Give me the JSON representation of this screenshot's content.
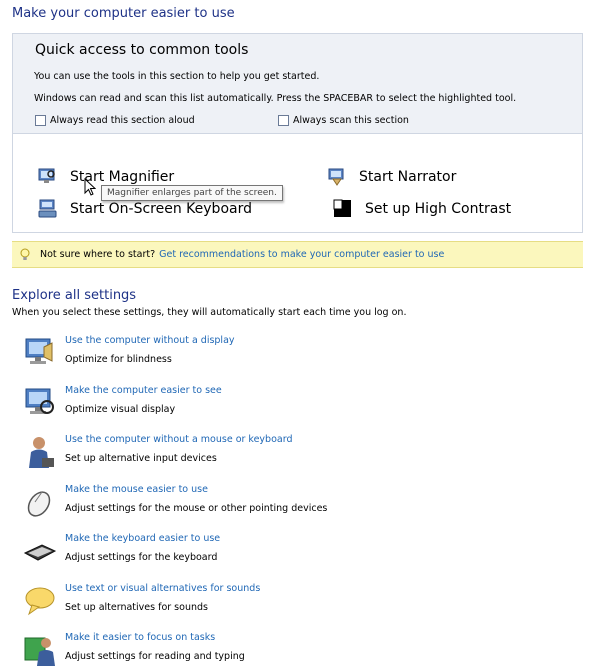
{
  "page": {
    "title": "Make your computer easier to use"
  },
  "quick_access": {
    "title": "Quick access to common tools",
    "line1": "You can use the tools in this section to help you get started.",
    "line2": "Windows can read and scan this list automatically.  Press the SPACEBAR to select the highlighted tool.",
    "checkbox_read": "Always read this section aloud",
    "checkbox_scan": "Always scan this section"
  },
  "tools": {
    "magnifier": "Start Magnifier",
    "narrator": "Start Narrator",
    "keyboard": "Start On-Screen Keyboard",
    "contrast": "Set up High Contrast",
    "tooltip": "Magnifier enlarges part of the screen."
  },
  "hint": {
    "question": "Not sure where to start?",
    "link": "Get recommendations to make your computer easier to use"
  },
  "explore": {
    "title": "Explore all settings",
    "description": "When you select these settings, they will automatically start each time you log on.",
    "items": [
      {
        "link": "Use the computer without a display",
        "desc": "Optimize for blindness",
        "icon": "monitor-icon"
      },
      {
        "link": "Make the computer easier to see",
        "desc": "Optimize visual display",
        "icon": "display-icon"
      },
      {
        "link": "Use the computer without a mouse or keyboard",
        "desc": "Set up alternative input devices",
        "icon": "person-icon"
      },
      {
        "link": "Make the mouse easier to use",
        "desc": "Adjust settings for the mouse or other pointing devices",
        "icon": "mouse-icon"
      },
      {
        "link": "Make the keyboard easier to use",
        "desc": "Adjust settings for the keyboard",
        "icon": "keyboard-icon"
      },
      {
        "link": "Use text or visual alternatives for sounds",
        "desc": "Set up alternatives for sounds",
        "icon": "speech-bubble-icon"
      },
      {
        "link": "Make it easier to focus on tasks",
        "desc": "Adjust settings for reading and typing",
        "icon": "users-icon"
      }
    ]
  },
  "colors": {
    "link": "#1f67b5",
    "heading": "#1e3287",
    "hint_background": "#fbf7bd"
  }
}
